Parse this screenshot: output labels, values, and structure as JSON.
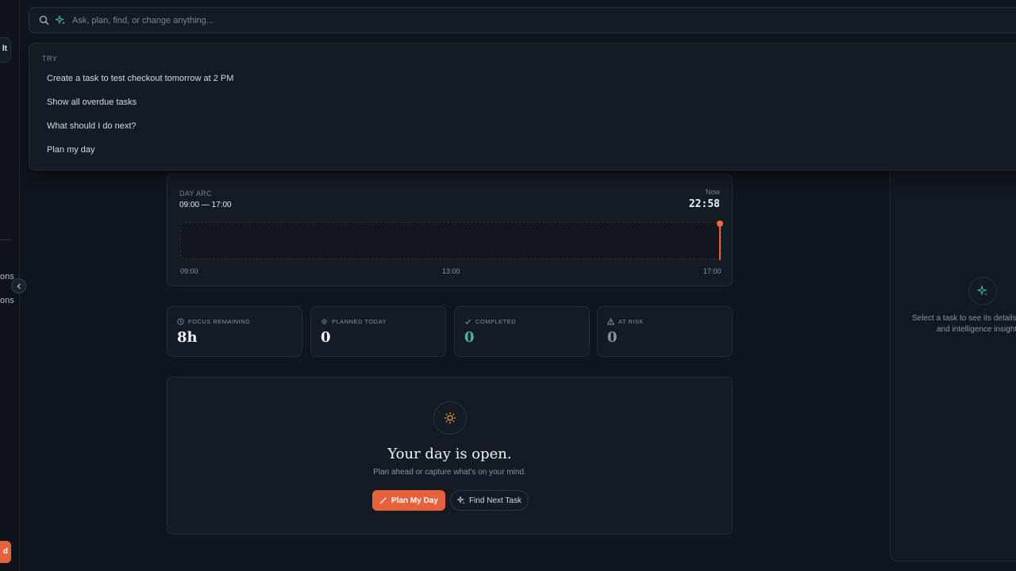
{
  "sidebar": {
    "chip_text": "lt",
    "items": [
      "ons",
      "ons"
    ],
    "bottom_button": "d"
  },
  "command_bar": {
    "placeholder": "Ask, plan, find, or change anything..."
  },
  "suggestions": {
    "label": "TRY",
    "items": [
      "Create a task to test checkout tomorrow at 2 PM",
      "Show all overdue tasks",
      "What should I do next?",
      "Plan my day"
    ]
  },
  "day_arc": {
    "label": "DAY ARC",
    "range": "09:00 — 17:00",
    "now_label": "Now",
    "now_time": "22:58",
    "ticks": [
      "09:00",
      "13:00",
      "17:00"
    ]
  },
  "stats": [
    {
      "label": "FOCUS REMAINING",
      "value": "8h",
      "icon": "clock-icon",
      "color": "#f0f4f8"
    },
    {
      "label": "PLANNED TODAY",
      "value": "0",
      "icon": "sun-icon",
      "color": "#f0f4f8"
    },
    {
      "label": "COMPLETED",
      "value": "0",
      "icon": "check-icon",
      "color": "#3fb9a6"
    },
    {
      "label": "AT RISK",
      "value": "0",
      "icon": "warning-icon",
      "color": "#8b949e"
    }
  ],
  "empty_state": {
    "title": "Your day is open.",
    "subtitle": "Plan ahead or capture what's on your mind.",
    "primary_button": "Plan My Day",
    "secondary_button": "Find Next Task"
  },
  "right_panel": {
    "text_line1": "Select a task to see its details",
    "text_line2": "and intelligence insights"
  },
  "colors": {
    "accent": "#e8613d",
    "teal": "#3fb9a6",
    "background": "#10161d"
  }
}
